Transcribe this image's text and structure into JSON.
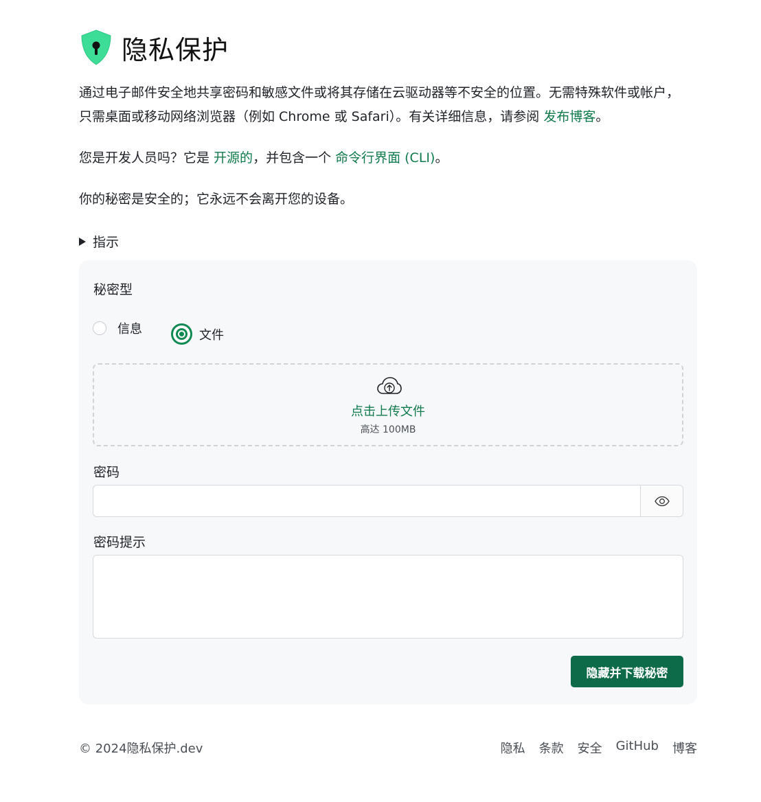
{
  "header": {
    "title": "隐私保护"
  },
  "intro": {
    "text": "通过电子邮件安全地共享密码和敏感文件或将其存储在云驱动器等不安全的位置。无需特殊软件或帐户，只需桌面或移动网络浏览器（例如 Chrome 或 Safari）。有关详细信息，请参阅 ",
    "blog_link": "发布博客",
    "end": "。"
  },
  "dev": {
    "prefix": "您是开发人员吗？它是 ",
    "open_source_link": "开源的",
    "middle": "，并包含一个 ",
    "cli_link": "命令行界面 (CLI)",
    "end": "。"
  },
  "safe_text": "你的秘密是安全的；它永远不会离开您的设备。",
  "instructions_label": "指示",
  "form": {
    "type_label": "秘密型",
    "radio_message": "信息",
    "radio_file": "文件",
    "selected": "file",
    "upload_text": "点击上传文件",
    "upload_limit": "高达 100MB",
    "password_label": "密码",
    "password_value": "",
    "hint_label": "密码提示",
    "hint_value": "",
    "submit_label": "隐藏并下载秘密"
  },
  "footer": {
    "copyright": "© 2024隐私保护.dev",
    "links": [
      "隐私",
      "条款",
      "安全",
      "GitHub",
      "博客"
    ]
  },
  "colors": {
    "accent": "#0f7a4b",
    "button": "#0e6b4a",
    "logo": "#3ddc97"
  },
  "icons": [
    "shield-keyhole-icon",
    "cloud-upload-icon",
    "eye-icon",
    "triangle-right-icon"
  ]
}
